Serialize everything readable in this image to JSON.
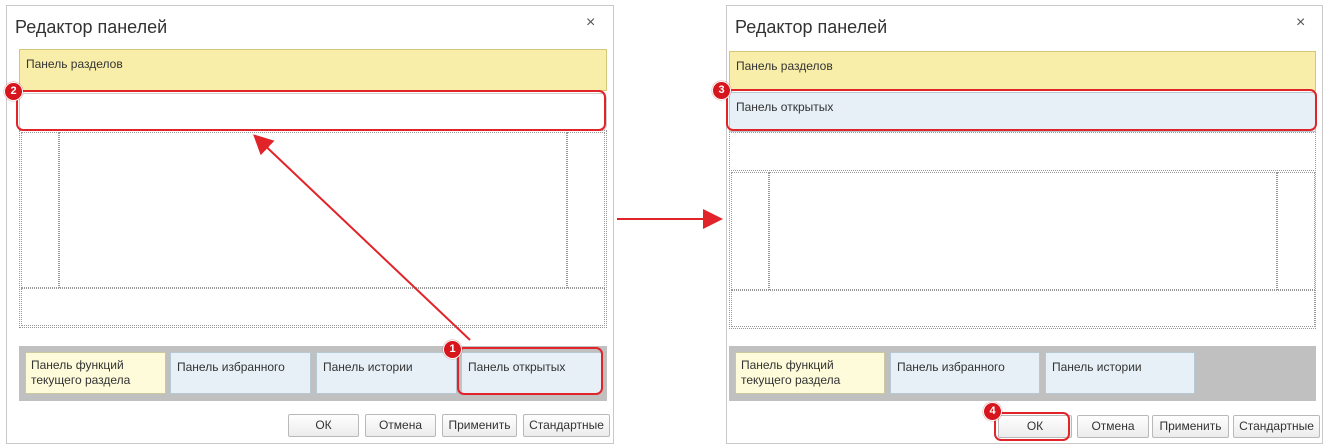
{
  "left_dialog": {
    "title": "Редактор панелей",
    "close_glyph": "×",
    "top_panel": "Панель разделов",
    "bottom_panels": [
      "Панель функций текущего раздела",
      "Панель избранного",
      "Панель истории",
      "Панель открытых"
    ],
    "buttons": {
      "ok": "ОК",
      "cancel": "Отмена",
      "apply": "Применить",
      "standard": "Стандартные"
    }
  },
  "right_dialog": {
    "title": "Редактор панелей",
    "close_glyph": "×",
    "top_panel": "Панель разделов",
    "second_panel": "Панель открытых",
    "bottom_panels": [
      "Панель функций текущего раздела",
      "Панель избранного",
      "Панель истории"
    ],
    "buttons": {
      "ok": "ОК",
      "cancel": "Отмена",
      "apply": "Применить",
      "standard": "Стандартные"
    }
  },
  "markers": [
    "1",
    "2",
    "3",
    "4"
  ],
  "colors": {
    "highlight": "#e0242a",
    "yellow_panel": "#f8eeaa",
    "blue_panel": "#e6f0f6"
  }
}
